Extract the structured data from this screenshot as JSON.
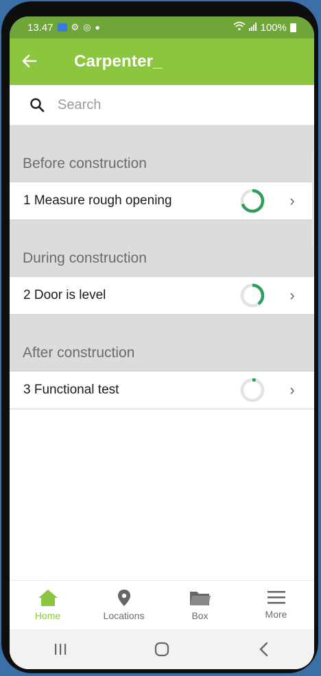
{
  "status_bar": {
    "time": "13.47",
    "battery": "100%"
  },
  "app_bar": {
    "title": "Carpenter_"
  },
  "search": {
    "placeholder": "Search"
  },
  "sections": [
    {
      "title": "Before construction",
      "items": [
        {
          "label": "1 Measure rough opening",
          "progress": 0.7
        }
      ]
    },
    {
      "title": "During construction",
      "items": [
        {
          "label": "2 Door is level",
          "progress": 0.4
        }
      ]
    },
    {
      "title": "After construction",
      "items": [
        {
          "label": "3 Functional test",
          "progress": 0.05
        }
      ]
    }
  ],
  "bottom_nav": [
    {
      "label": "Home",
      "icon": "home-icon",
      "active": true
    },
    {
      "label": "Locations",
      "icon": "location-pin-icon",
      "active": false
    },
    {
      "label": "Box",
      "icon": "folder-icon",
      "active": false
    },
    {
      "label": "More",
      "icon": "menu-icon",
      "active": false
    }
  ],
  "colors": {
    "status_bar": "#6fa63a",
    "app_bar": "#8cc63f",
    "progress": "#2e9e5a",
    "progress_track": "#e3e3e3",
    "active_nav": "#8cc63f"
  }
}
